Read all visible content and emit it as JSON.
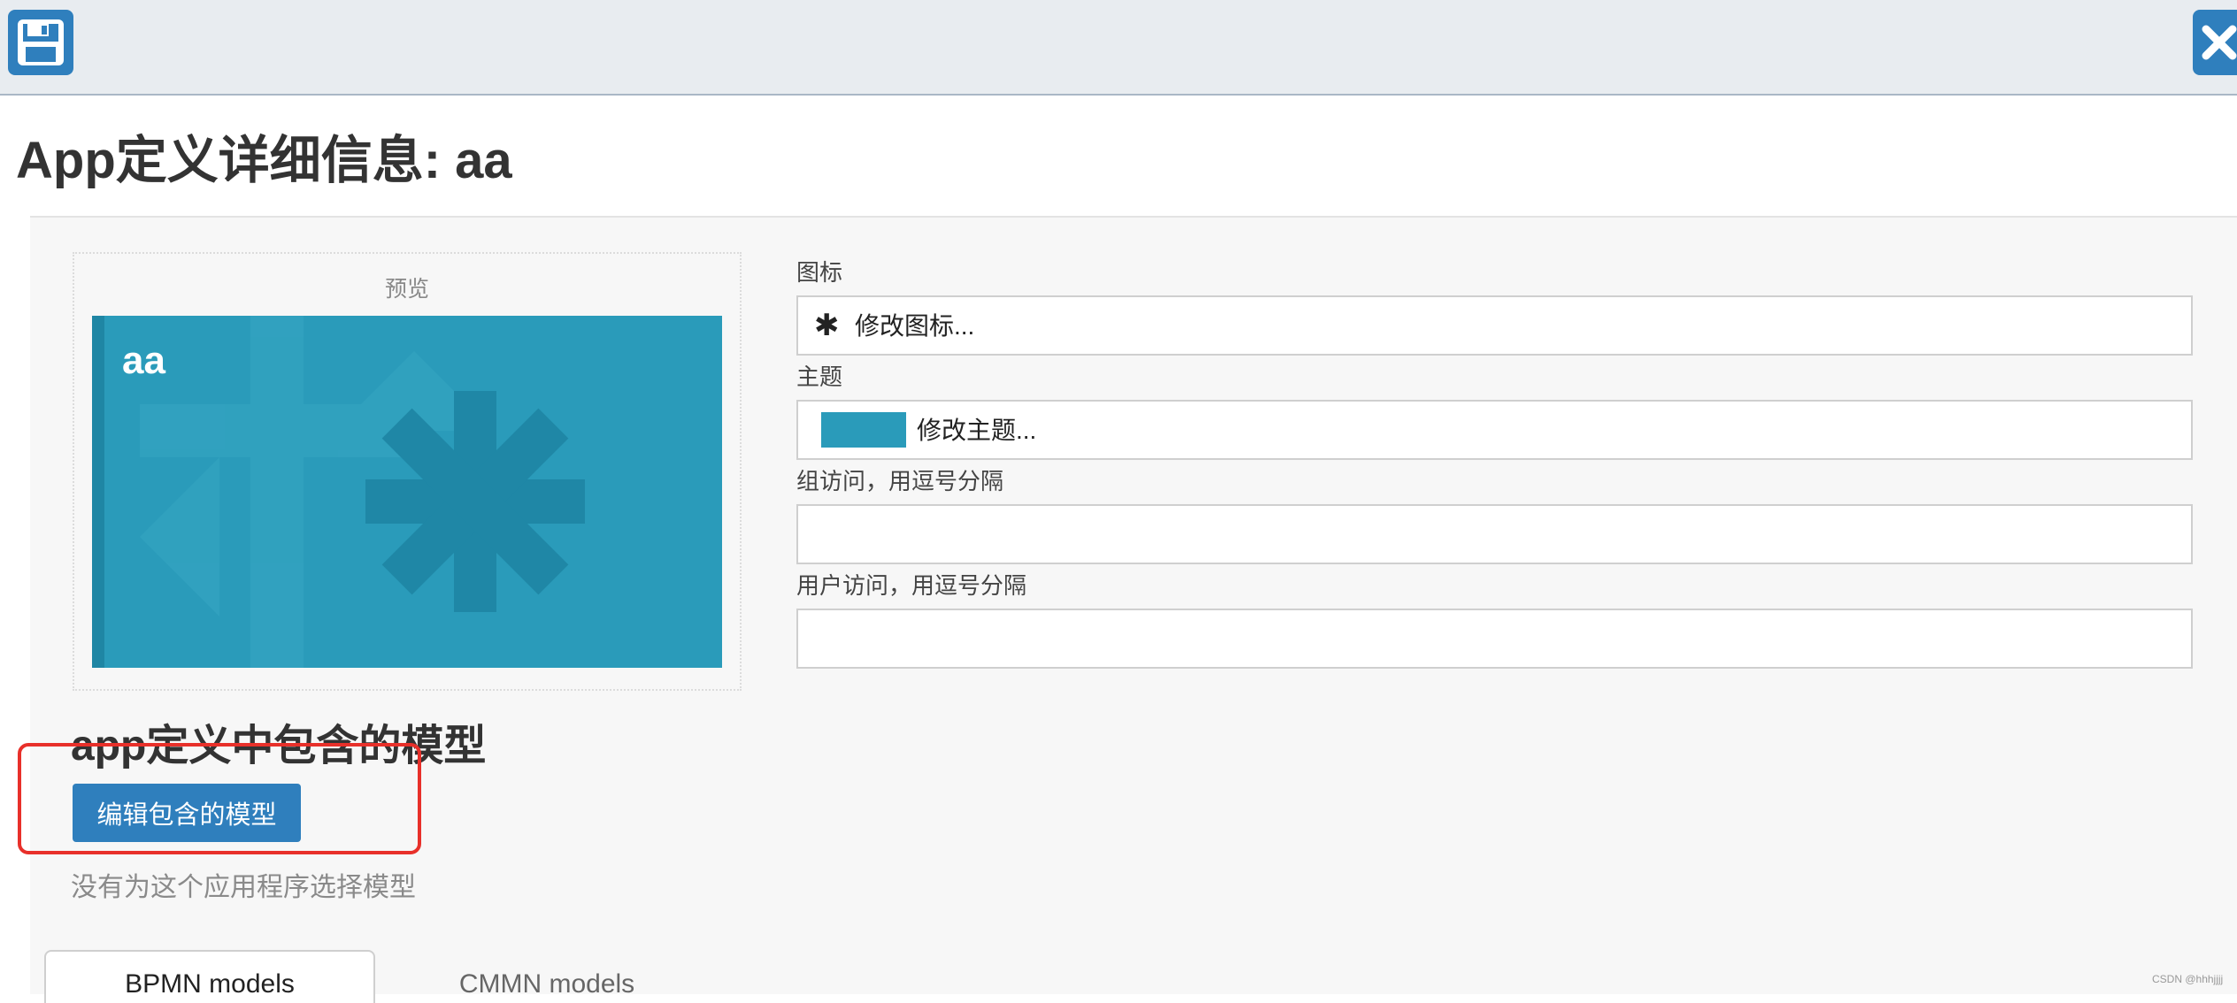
{
  "toolbar": {
    "save_icon": "floppy-disk-icon",
    "close_icon": "close-x-icon",
    "accent_color": "#2f7fbd"
  },
  "page_title": "App定义详细信息: aa",
  "preview": {
    "label": "预览",
    "tile_name": "aa",
    "tile_color": "#2a9bba",
    "tile_icon": "asterisk-icon"
  },
  "fields": {
    "icon": {
      "label": "图标",
      "value": "修改图标...",
      "icon": "asterisk-icon"
    },
    "theme": {
      "label": "主题",
      "value": "修改主题...",
      "swatch_color": "#2a9bba"
    },
    "group_access": {
      "label": "组访问，用逗号分隔",
      "value": ""
    },
    "user_access": {
      "label": "用户访问，用逗号分隔",
      "value": ""
    }
  },
  "models": {
    "heading": "app定义中包含的模型",
    "edit_button": "编辑包含的模型",
    "empty_message": "没有为这个应用程序选择模型"
  },
  "tabs": [
    {
      "label": "BPMN models",
      "active": true
    },
    {
      "label": "CMMN models",
      "active": false
    }
  ],
  "watermark": "CSDN @hhhjjjj"
}
